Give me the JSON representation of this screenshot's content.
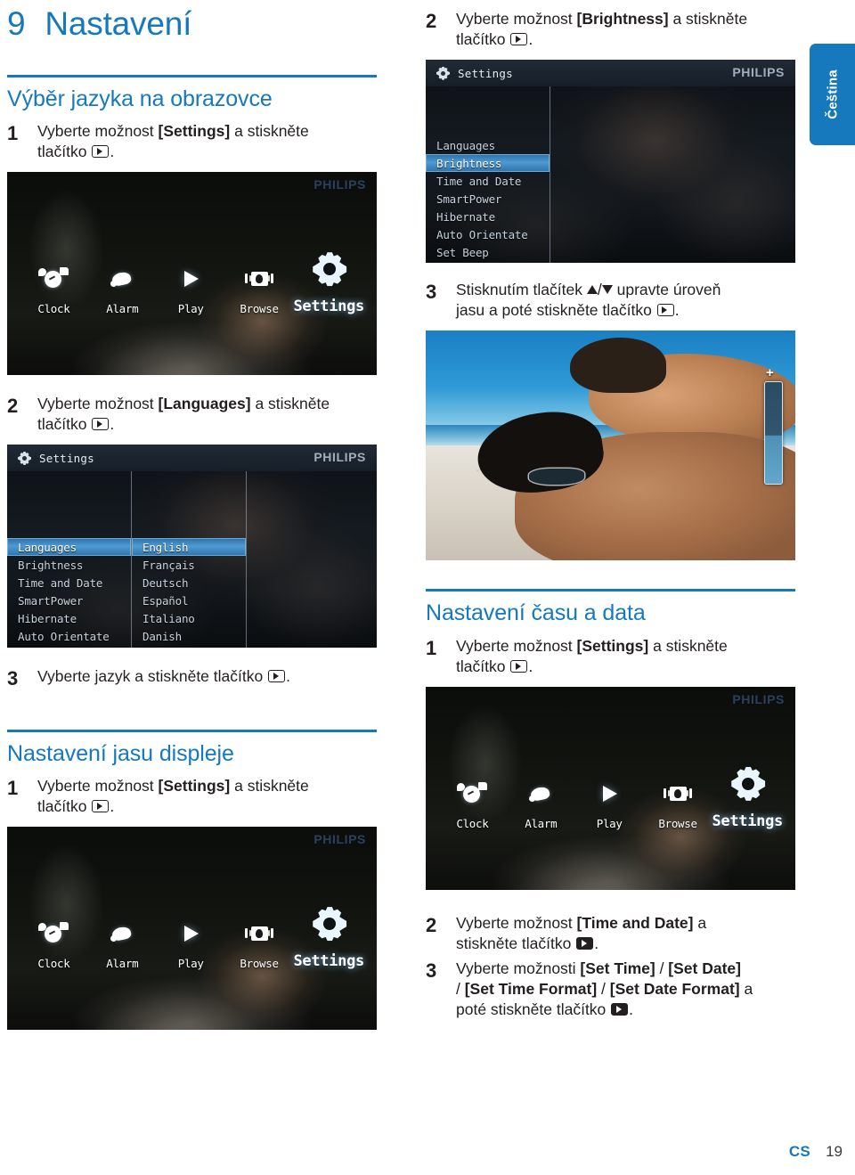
{
  "chapter": {
    "number": "9",
    "title": "Nastavení"
  },
  "language_tab": {
    "label": "Čeština"
  },
  "footer": {
    "locale": "CS",
    "page": "19"
  },
  "sections": {
    "onscreen_language": {
      "title": "Výběr jazyka na obrazovce",
      "steps": [
        {
          "num": "1",
          "parts": [
            "Vyberte možnost ",
            "[Settings]",
            " a stiskněte tlačítko "
          ],
          "bold_index": 1,
          "end": "."
        },
        {
          "num": "2",
          "parts": [
            "Vyberte možnost ",
            "[Languages]",
            " a stiskněte tlačítko "
          ],
          "bold_index": 1,
          "end": "."
        },
        {
          "num": "3",
          "parts": [
            "Vyberte jazyk a stiskněte tlačítko "
          ],
          "end": "."
        }
      ]
    },
    "display_brightness": {
      "title": "Nastavení jasu displeje",
      "steps": [
        {
          "num": "1",
          "parts": [
            "Vyberte možnost ",
            "[Settings]",
            " a stiskněte tlačítko "
          ],
          "end": "."
        },
        {
          "num": "2",
          "parts": [
            "Vyberte možnost ",
            "[Brightness]",
            " a stiskněte tlačítko "
          ],
          "end": "."
        },
        {
          "num": "3",
          "parts": [
            "Stisknutím tlačítek ",
            "▲/▼",
            " upravte úroveň jasu a poté stiskněte tlačítko "
          ],
          "end": "."
        }
      ]
    },
    "time_and_date": {
      "title": "Nastavení času a data",
      "steps": [
        {
          "num": "1",
          "parts": [
            "Vyberte možnost ",
            "[Settings]",
            " a stiskněte tlačítko "
          ],
          "end": "."
        },
        {
          "num": "2",
          "parts": [
            "Vyberte možnost ",
            "[Time and Date]",
            " a stiskněte tlačítko "
          ],
          "end": "."
        },
        {
          "num": "3",
          "parts": [
            "Vyberte možnosti ",
            "[Set Time] / [Set Date] / [Set Time Format] / [Set Date Format]",
            " a poté stiskněte tlačítko "
          ],
          "end": "."
        }
      ]
    }
  },
  "step_text": {
    "s1_a": "Vyberte možnost ",
    "s1_bold": "[Settings]",
    "s1_b": " a stiskněte",
    "s1_c": "tlačítko",
    "s2_lang_bold": "[Languages]",
    "s3_lang": "Vyberte jazyk a stiskněte tlačítko",
    "s2_bright_bold": "[Brightness]",
    "s3_bright_a": "Stisknutím tlačítek",
    "s3_bright_b": "upravte úroveň",
    "s3_bright_c": "jasu a poté stiskněte tlačítko",
    "s2_time_bold": "[Time and Date]",
    "s2_time_a": "Vyberte možnost ",
    "s2_time_b": " a",
    "s2_time_c": "stiskněte tlačítko",
    "s3_time_a": "Vyberte možnosti ",
    "s3_time_b1": "[Set Time]",
    "s3_time_sep": " / ",
    "s3_time_b2": "[Set Date]",
    "s3_time_b3": "[Set Time Format]",
    "s3_time_b4": "[Set Date Format]",
    "s3_time_c": " a",
    "s3_time_d": "poté stiskněte tlačítko",
    "dot": "."
  },
  "device_screens": {
    "home": {
      "brand": "PHILIPS",
      "items": [
        {
          "label": "Clock",
          "icon": "clock-icon",
          "active": false
        },
        {
          "label": "Alarm",
          "icon": "bell-icon",
          "active": false
        },
        {
          "label": "Play",
          "icon": "play-icon",
          "active": false
        },
        {
          "label": "Browse",
          "icon": "browse-icon",
          "active": false
        },
        {
          "label": "Settings",
          "icon": "gear-icon",
          "active": true
        }
      ]
    },
    "settings_menu": {
      "brand": "PHILIPS",
      "title": "Settings",
      "items": [
        "Languages",
        "Brightness",
        "Time and Date",
        "SmartPower",
        "Hibernate",
        "Auto Orientate",
        "Set Beep"
      ],
      "selected": "Brightness"
    },
    "languages_menu": {
      "brand": "PHILIPS",
      "title": "Settings",
      "items": [
        "Languages",
        "Brightness",
        "Time and Date",
        "SmartPower",
        "Hibernate",
        "Auto Orientate"
      ],
      "selected": "Languages",
      "languages": [
        "English",
        "Français",
        "Deutsch",
        "Español",
        "Italiano",
        "Danish"
      ],
      "language_selected": "English"
    },
    "brightness_photo": {
      "slider_plus": "+"
    }
  }
}
